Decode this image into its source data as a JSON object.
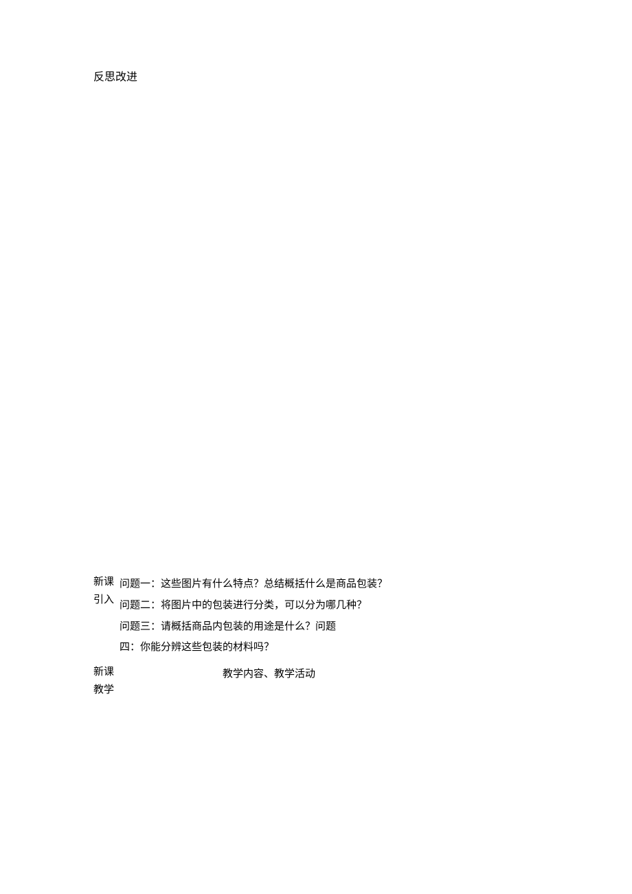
{
  "heading": "反思改进",
  "section1": {
    "label_line1": "新课",
    "label_line2": "引入",
    "questions": {
      "q1": "问题一：这些图片有什么特点？总结概括什么是商品包装？",
      "q2": "问题二：将图片中的包装进行分类，可以分为哪几种？",
      "q3": "问题三：请概括商品内包装的用途是什么？问题",
      "q4": "四：你能分辨这些包装的材料吗？"
    }
  },
  "section2": {
    "label_line1": "新课",
    "label_line2": "教学",
    "center_text": "教学内容、教学活动"
  }
}
